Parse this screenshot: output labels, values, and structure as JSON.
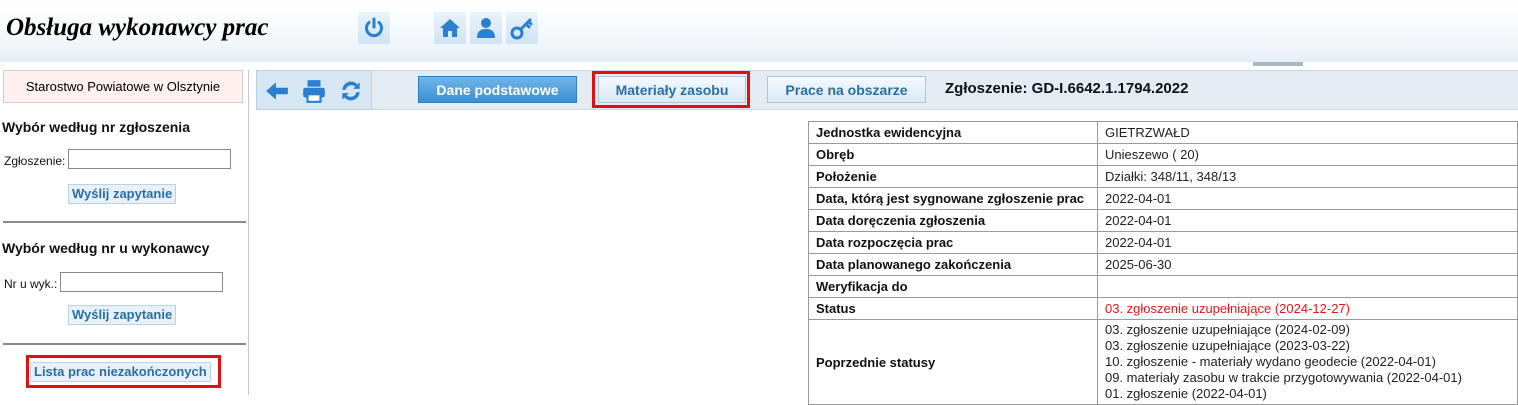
{
  "app": {
    "title": "Obsługa wykonawcy prac"
  },
  "header": {
    "icons": [
      "power-icon",
      "home-icon",
      "user-icon",
      "key-icon"
    ]
  },
  "left": {
    "office": "Starostwo Powiatowe w Olsztynie",
    "section1": {
      "title": "Wybór według nr zgłoszenia",
      "label": "Zgłoszenie:",
      "value": "",
      "button": "Wyślij zapytanie"
    },
    "section2": {
      "title": "Wybór według nr u wykonawcy",
      "label": "Nr u wyk.:",
      "value": "",
      "button": "Wyślij zapytanie"
    },
    "list_button": "Lista prac niezakończonych"
  },
  "toolbar": {
    "icons": [
      "back-arrow-icon",
      "print-icon",
      "refresh-icon"
    ],
    "tabs": {
      "basic": "Dane podstawowe",
      "materials": "Materiały zasobu",
      "area": "Prace na obszarze"
    },
    "submission": "Zgłoszenie: GD-I.6642.1.1794.2022"
  },
  "details": {
    "rows": [
      {
        "key": "Jednostka ewidencyjna",
        "value": "GIETRZWAŁD"
      },
      {
        "key": "Obręb",
        "value": "Unieszewo ( 20)"
      },
      {
        "key": "Położenie",
        "value": "Działki: 348/11, 348/13"
      },
      {
        "key": "Data, którą jest sygnowane zgłoszenie prac",
        "value": "2022-04-01"
      },
      {
        "key": "Data doręczenia zgłoszenia",
        "value": "2022-04-01"
      },
      {
        "key": "Data rozpoczęcia prac",
        "value": "2022-04-01"
      },
      {
        "key": "Data planowanego zakończenia",
        "value": "2025-06-30"
      },
      {
        "key": "Weryfikacja do",
        "value": ""
      },
      {
        "key": "Status",
        "value": "03. zgłoszenie uzupełniające (2024-12-27)"
      }
    ],
    "previous": {
      "key": "Poprzednie statusy",
      "items": [
        "03. zgłoszenie uzupełniające (2024-02-09)",
        "03. zgłoszenie uzupełniające (2023-03-22)",
        "10. zgłoszenie - materiały wydano geodecie (2022-04-01)",
        "09. materiały zasobu w trakcie przygotowywania (2022-04-01)",
        "01. zgłoszenie (2022-04-01)"
      ]
    }
  },
  "colors": {
    "status_red": "#e01818",
    "accent_blue": "#3b8fd3",
    "highlight_red": "#e01010"
  }
}
